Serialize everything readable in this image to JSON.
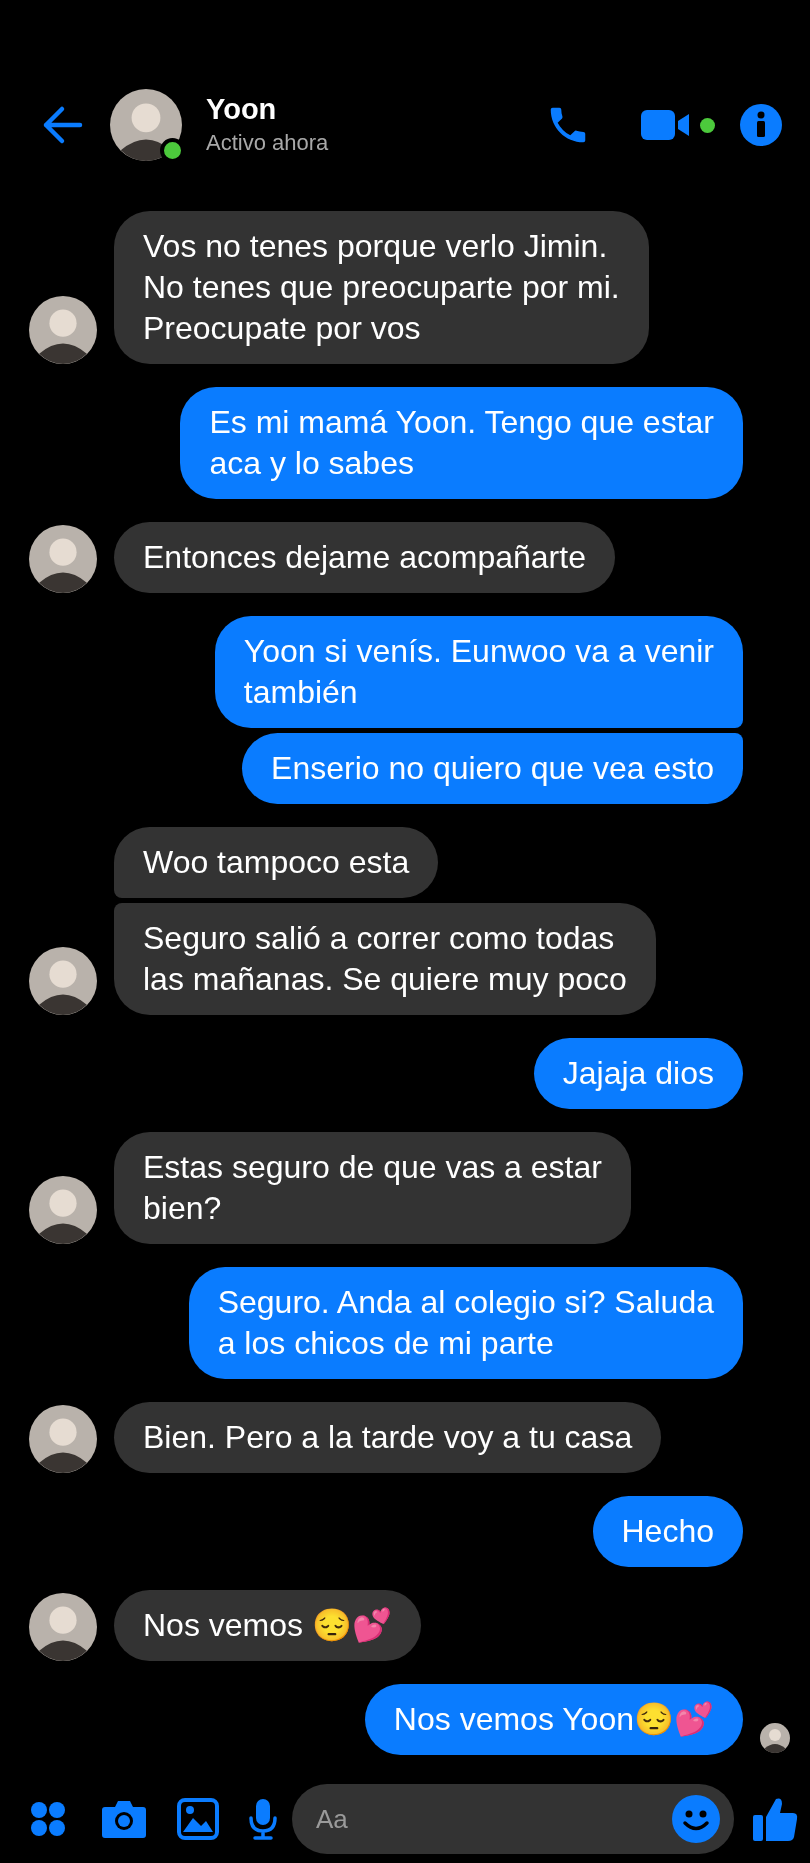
{
  "header": {
    "name": "Yoon",
    "status": "Activo ahora",
    "online": true
  },
  "messages": [
    {
      "kind": "incoming",
      "text": "Vos no tenes porque verlo Jimin.\nNo tenes que preocuparte por mi.\nPreocupate por vos",
      "avatar": true
    },
    {
      "kind": "outgoing",
      "text": "Es mi mamá Yoon. Tengo que estar\naca y lo sabes",
      "avatar": false
    },
    {
      "kind": "incoming",
      "text": "Entonces dejame acompañarte",
      "avatar": true
    },
    {
      "kind": "outgoing",
      "text": "Yoon si venís. Eunwoo va a venir\ntambién",
      "avatar": false
    },
    {
      "kind": "outgoing",
      "text": "Enserio no quiero que vea esto",
      "avatar": false
    },
    {
      "kind": "incoming",
      "text": "Woo tampoco esta",
      "avatar": false
    },
    {
      "kind": "incoming",
      "text": "Seguro salió a correr como todas\nlas mañanas. Se quiere muy poco",
      "avatar": true
    },
    {
      "kind": "outgoing",
      "text": "Jajaja dios",
      "avatar": false
    },
    {
      "kind": "incoming",
      "text": "Estas seguro de que vas a estar\nbien?",
      "avatar": true
    },
    {
      "kind": "outgoing",
      "text": "Seguro. Anda al colegio si? Saluda\na los chicos de mi parte",
      "avatar": false
    },
    {
      "kind": "incoming",
      "text": "Bien. Pero a la tarde voy a tu casa",
      "avatar": true
    },
    {
      "kind": "outgoing",
      "text": "Hecho",
      "avatar": false
    },
    {
      "kind": "incoming",
      "text": "Nos vemos 😔💕",
      "avatar": true
    },
    {
      "kind": "outgoing",
      "text": "Nos vemos Yoon😔💕",
      "avatar": true
    }
  ],
  "composer": {
    "placeholder": "Aa"
  }
}
